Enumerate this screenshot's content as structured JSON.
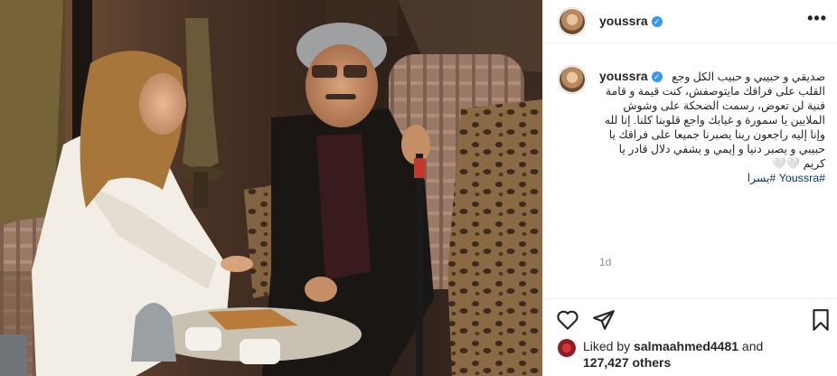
{
  "post": {
    "username": "youssra",
    "verified_badge": "✓",
    "more_label": "•••",
    "caption_line1": "صديقي و حبيبي و حبيب الكل وجع",
    "caption_rest": "القلب على فراقك مايتوصفش، كنت قيمة و قامة فنية لن تعوض، رسمت الضحكة على وشوش الملايين يا سمورة و غيابك واجع قلوبنا كلنا. إنا لله وإنا إليه راجعون ربنا يصبرنا جميعا على فراقك يا حبيبي و يصبر دنيا و إيمي و يشفي دلال قادر يا كريم 🤍🤍",
    "hashtags": "#Youssra #يسرا",
    "time_ago": "1d"
  },
  "likes": {
    "prefix": "Liked by ",
    "user": "salmaahmed4481",
    "joiner": " and",
    "count": "127,427 others"
  },
  "icons": {
    "like": "heart-icon",
    "share": "paper-plane-icon",
    "save": "bookmark-icon",
    "more": "ellipsis-icon"
  },
  "colors": {
    "verified": "#3897f0",
    "hashtag": "#00376b",
    "muted": "#8e8e8e"
  }
}
